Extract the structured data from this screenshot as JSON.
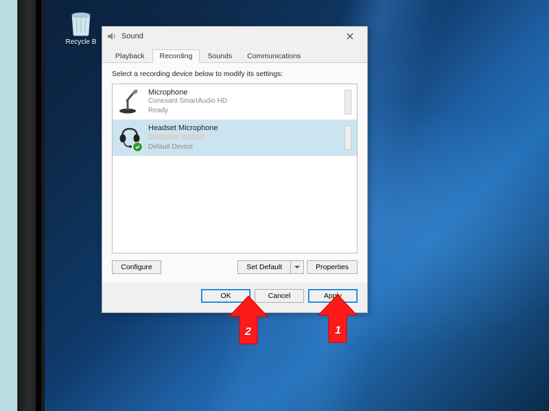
{
  "desktop": {
    "recycle_label": "Recycle B"
  },
  "dialog": {
    "title": "Sound",
    "tabs": [
      "Playback",
      "Recording",
      "Sounds",
      "Communications"
    ],
    "active_tab": 1,
    "heading": "Select a recording device below to modify its settings:",
    "devices": [
      {
        "name": "Microphone",
        "driver": "Conexant SmartAudio HD",
        "status": "Ready",
        "default": false,
        "selected": false,
        "icon": "mic-stand-icon"
      },
      {
        "name": "Headset Microphone",
        "driver": "",
        "status": "Default Device",
        "default": true,
        "selected": true,
        "icon": "headset-icon"
      }
    ],
    "buttons": {
      "configure": "Configure",
      "set_default": "Set Default",
      "properties": "Properties",
      "ok": "OK",
      "cancel": "Cancel",
      "apply": "Apply"
    }
  },
  "annotations": [
    {
      "num": "1",
      "target": "apply-button"
    },
    {
      "num": "2",
      "target": "ok-button"
    }
  ]
}
